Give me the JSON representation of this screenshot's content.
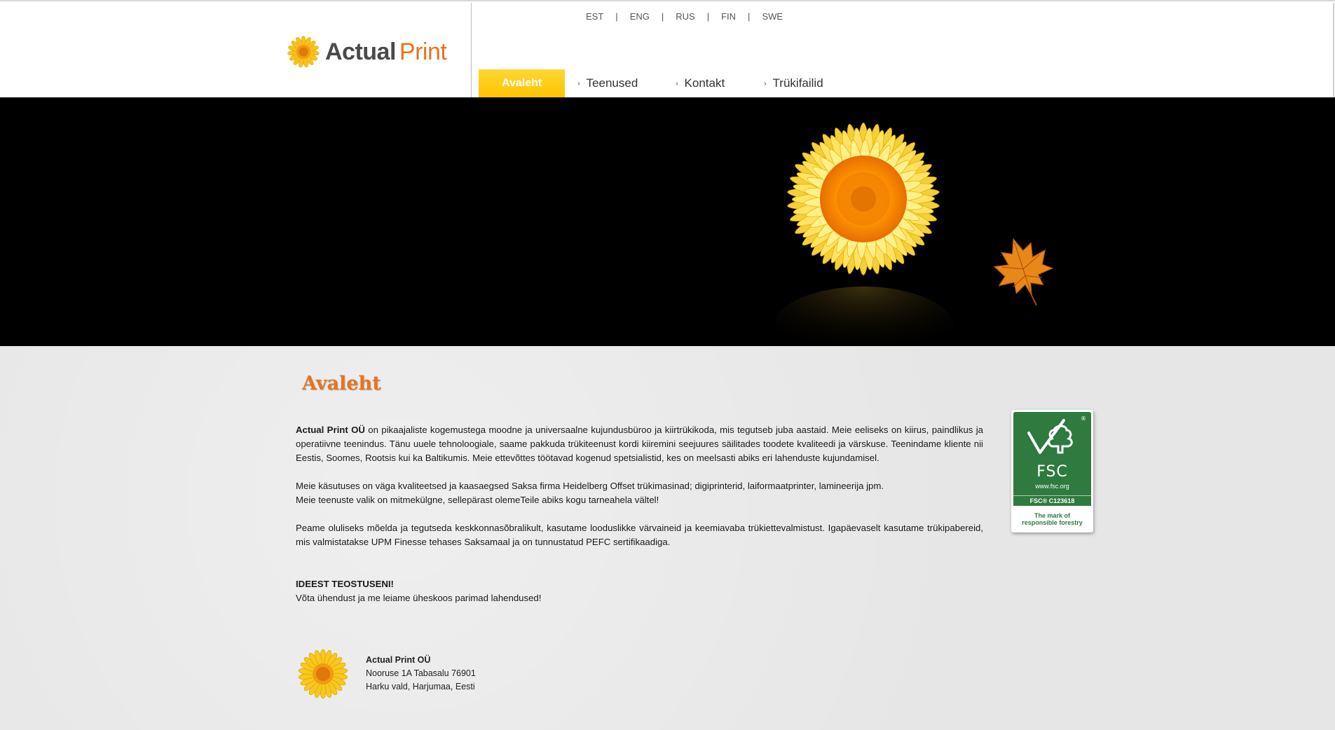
{
  "brand": {
    "name_part1": "Actual",
    "name_part2": "Print",
    "accent_color": "#e8731f",
    "highlight_color": "#ffc400"
  },
  "languages": [
    "EST",
    "ENG",
    "RUS",
    "FIN",
    "SWE"
  ],
  "nav": {
    "items": [
      {
        "label": "Avaleht",
        "active": true
      },
      {
        "label": "Teenused",
        "active": false
      },
      {
        "label": "Kontakt",
        "active": false
      },
      {
        "label": "Trükifailid",
        "active": false
      }
    ]
  },
  "hero": {
    "background_color": "#000000",
    "icons": [
      "sunflower-image",
      "maple-leaf-image"
    ]
  },
  "page": {
    "title": "Avaleht",
    "intro_company": "Actual Print OÜ",
    "intro_text": " on pikaajaliste kogemustega moodne ja universaalne kujundusbüroo ja kiirtrükikoda, mis tegutseb juba aastaid. Meie eeliseks on kiirus, paindlikus ja operatiivne teenindus. Tänu uuele tehnoloogiale, saame pakkuda trükiteenust kordi kiiremini seejuures säilitades toodete kvaliteedi ja värskuse. Teenindame kliente nii Eestis, Soomes, Rootsis kui ka Baltikumis. Meie ettevõttes töötavad kogenud spetsialistid, kes on meelsasti abiks eri lahenduste kujundamisel.",
    "equipment_line1": "Meie käsutuses on väga kvaliteetsed ja kaasaegsed Saksa firma Heidelberg Offset trükimasinad; digiprinterid, laiformaatprinter, lamineerija jpm.",
    "equipment_line2": "Meie teenuste valik on mitmekülgne, sellepärast olemeTeile abiks kogu tarneahela vältel!",
    "eco_text": "Peame oluliseks mõelda ja tegutseda keskkonnasõbralikult, kasutame looduslikke värvaineid ja keemiavaba trükiettevalmistust. Igapäevaselt kasutame trükipabereid, mis valmistatakse UPM Finesse tehases Saksamaal ja on tunnustatud PEFC sertifikaadiga.",
    "slogan": "IDEEST TEOSTUSENI!",
    "cta": "Võta ühendust ja me leiame üheskoos parimad lahendused!"
  },
  "fsc": {
    "name": "FSC",
    "registered_mark": "®",
    "url": "www.fsc.org",
    "code": "FSC® C123618",
    "tagline_line1": "The mark of",
    "tagline_line2": "responsible forestry",
    "color": "#2f7a3f"
  },
  "footer": {
    "company": "Actual Print OÜ",
    "address_line1": "Nooruse 1A Tabasalu 76901",
    "address_line2": "Harku vald, Harjumaa, Eesti"
  }
}
